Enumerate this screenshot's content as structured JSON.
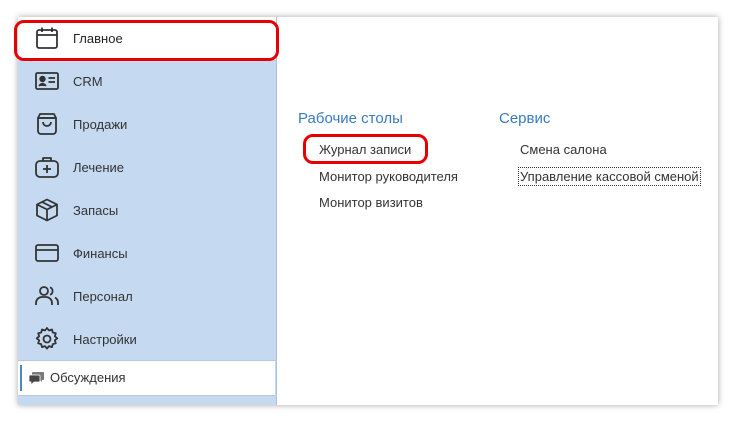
{
  "sidebar": {
    "items": [
      {
        "label": "Главное",
        "icon": "calendar-icon"
      },
      {
        "label": "CRM",
        "icon": "id-card-icon"
      },
      {
        "label": "Продажи",
        "icon": "shopping-bag-icon"
      },
      {
        "label": "Лечение",
        "icon": "medical-bag-icon"
      },
      {
        "label": "Запасы",
        "icon": "box-icon"
      },
      {
        "label": "Финансы",
        "icon": "credit-card-icon"
      },
      {
        "label": "Персонал",
        "icon": "users-icon"
      },
      {
        "label": "Настройки",
        "icon": "gear-icon"
      }
    ],
    "discussions": {
      "label": "Обсуждения",
      "icon": "chat-icon"
    }
  },
  "main": {
    "sections": [
      {
        "title": "Рабочие столы",
        "links": [
          "Журнал записи",
          "Монитор руководителя",
          "Монитор визитов"
        ]
      },
      {
        "title": "Сервис",
        "links": [
          "Смена салона",
          "Управление кассовой сменой"
        ]
      }
    ]
  },
  "colors": {
    "sidebar_bg": "#c5d9f1",
    "accent": "#3a7bbf",
    "highlight": "#e60000"
  }
}
